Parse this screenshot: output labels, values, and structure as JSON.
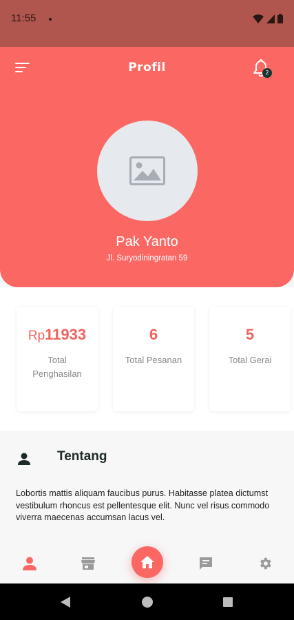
{
  "status_bar": {
    "time": "11:55",
    "icons": [
      "wifi-icon",
      "signal-icon",
      "battery-icon"
    ]
  },
  "header": {
    "title": "Profil",
    "notification_count": "2",
    "accent_color": "#fb6763"
  },
  "profile": {
    "name": "Pak Yanto",
    "address": "Jl. Suryodiningratan 59"
  },
  "stats": [
    {
      "prefix": "Rp",
      "value": "11933",
      "label": "Total Penghasilan"
    },
    {
      "prefix": "",
      "value": "6",
      "label": "Total Pesanan"
    },
    {
      "prefix": "",
      "value": "5",
      "label": "Total Gerai"
    }
  ],
  "about": {
    "title": "Tentang",
    "text": "Lobortis mattis aliquam faucibus purus. Habitasse platea dictumst vestibulum rhoncus est pellentesque elit. Nunc vel risus commodo viverra maecenas accumsan lacus vel."
  },
  "bottom_nav": {
    "items": [
      "profile-icon",
      "store-icon",
      "home-icon",
      "chat-icon",
      "settings-icon"
    ],
    "active": "profile-icon"
  }
}
